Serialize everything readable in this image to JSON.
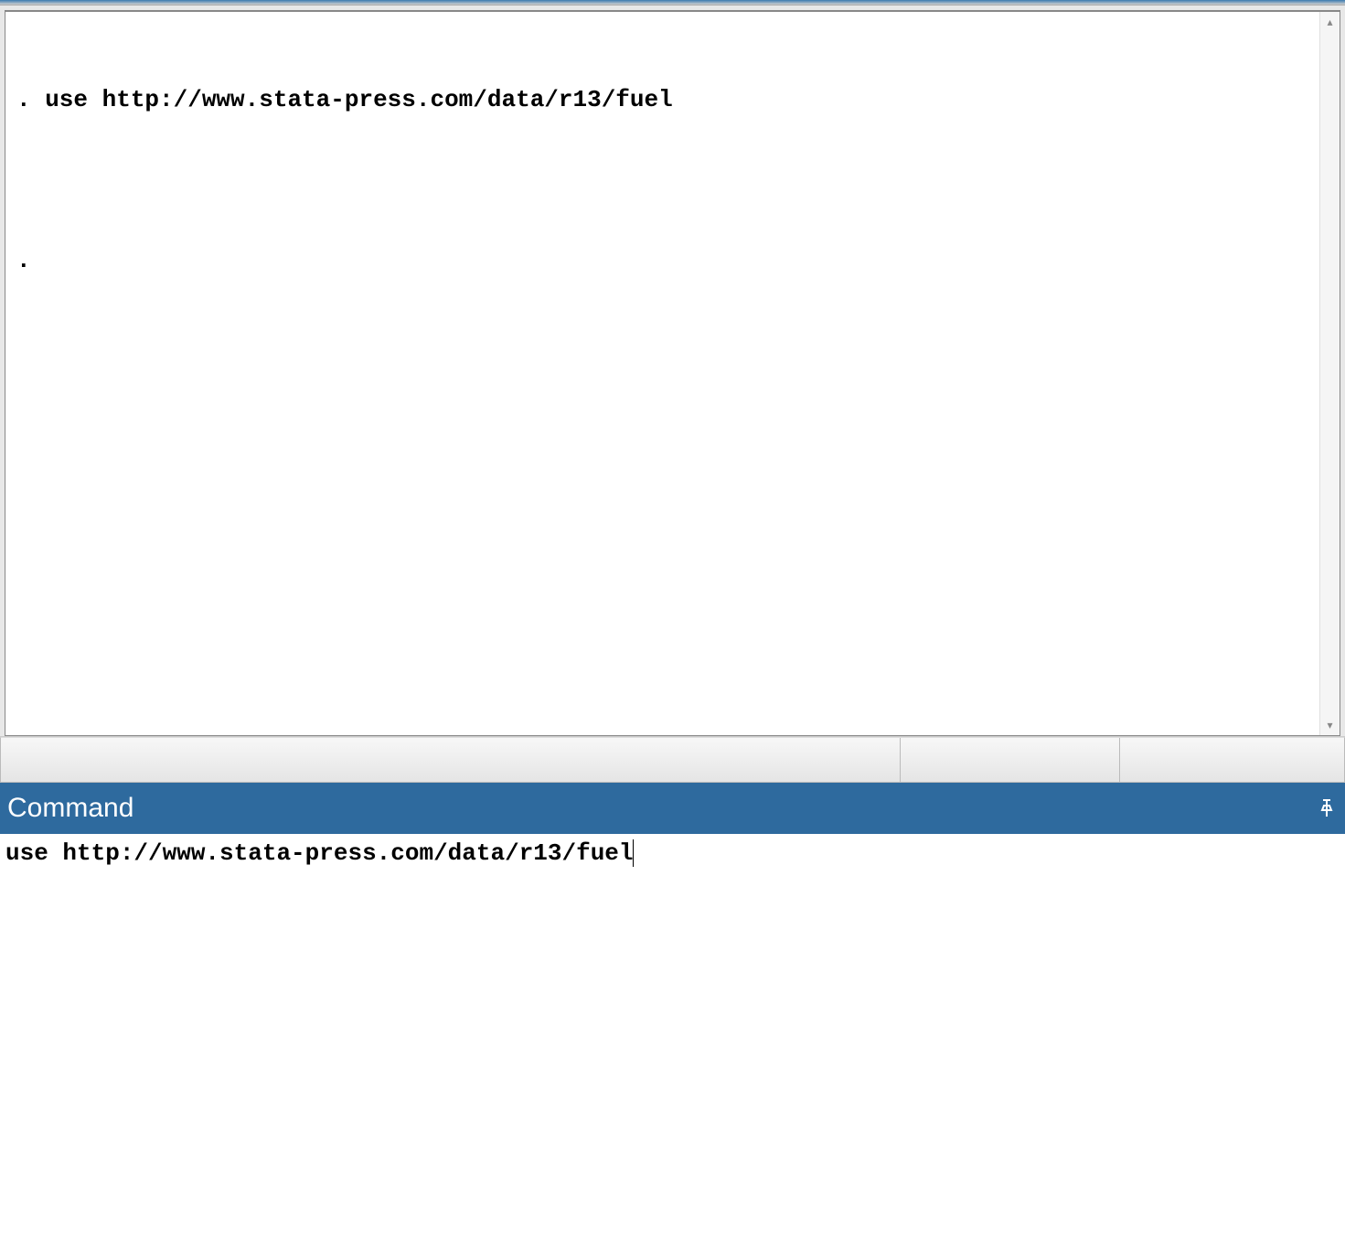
{
  "results": {
    "lines": [
      ". use http://www.stata-press.com/data/r13/fuel",
      "",
      "."
    ]
  },
  "command_panel": {
    "title": "Command",
    "input_value": "use http://www.stata-press.com/data/r13/fuel"
  },
  "icons": {
    "scroll_up": "▴",
    "scroll_down": "▾"
  }
}
